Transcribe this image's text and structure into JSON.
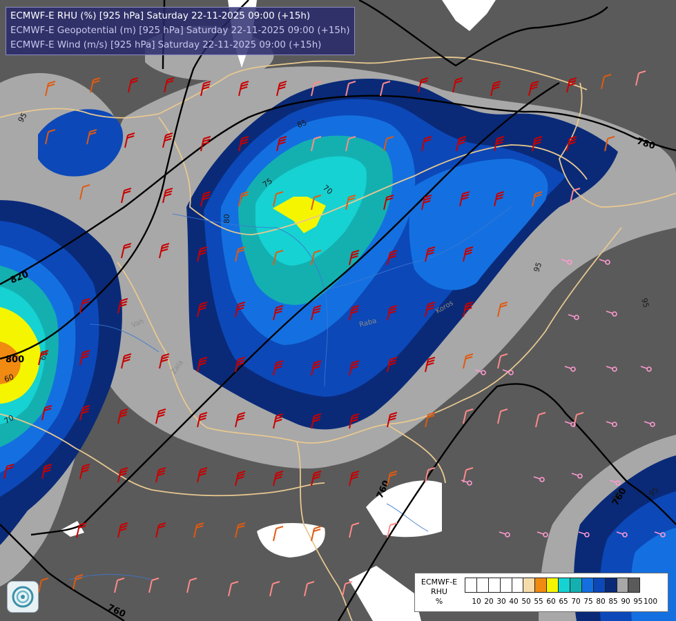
{
  "header": {
    "lines": [
      "ECMWF-E RHU (%) [925 hPa] Saturday 22-11-2025 09:00 (+15h)",
      "ECMWF-E Geopotential (m) [925 hPa] Saturday 22-11-2025 09:00 (+15h)",
      "ECMWF-E Wind (m/s) [925 hPa] Saturday 22-11-2025 09:00 (+15h)"
    ]
  },
  "legend": {
    "title_lines": [
      "ECMWF-E",
      "RHU",
      "%"
    ],
    "ticks": [
      "10",
      "20",
      "30",
      "40",
      "50",
      "55",
      "60",
      "65",
      "70",
      "75",
      "80",
      "85",
      "90",
      "95",
      "100"
    ],
    "colors": [
      "#ffffff",
      "#ffffff",
      "#ffffff",
      "#ffffff",
      "#ffffff",
      "#f5dcaa",
      "#f08a10",
      "#f5f500",
      "#16d2d2",
      "#14b0b0",
      "#1470e0",
      "#0c48b8",
      "#0a2a78",
      "#a8a8a8",
      "#5a5a5a"
    ]
  },
  "map": {
    "region": "Hungary and surrounding Carpathian basin",
    "geopotential_labels": [
      "780",
      "820",
      "800",
      "760",
      "760",
      "760"
    ],
    "rhu_labels": [
      "95",
      "85",
      "75",
      "80",
      "70",
      "95",
      "95",
      "90",
      "95",
      "60",
      "65",
      "70"
    ],
    "river_labels": [
      "Vah",
      "Zala",
      "Raba",
      "Koros"
    ],
    "wind_barb_colors": {
      "strong": "#c80000",
      "moderate": "#e05a10",
      "light": "#ff8a8a",
      "calm": "#ff9ad0"
    }
  }
}
